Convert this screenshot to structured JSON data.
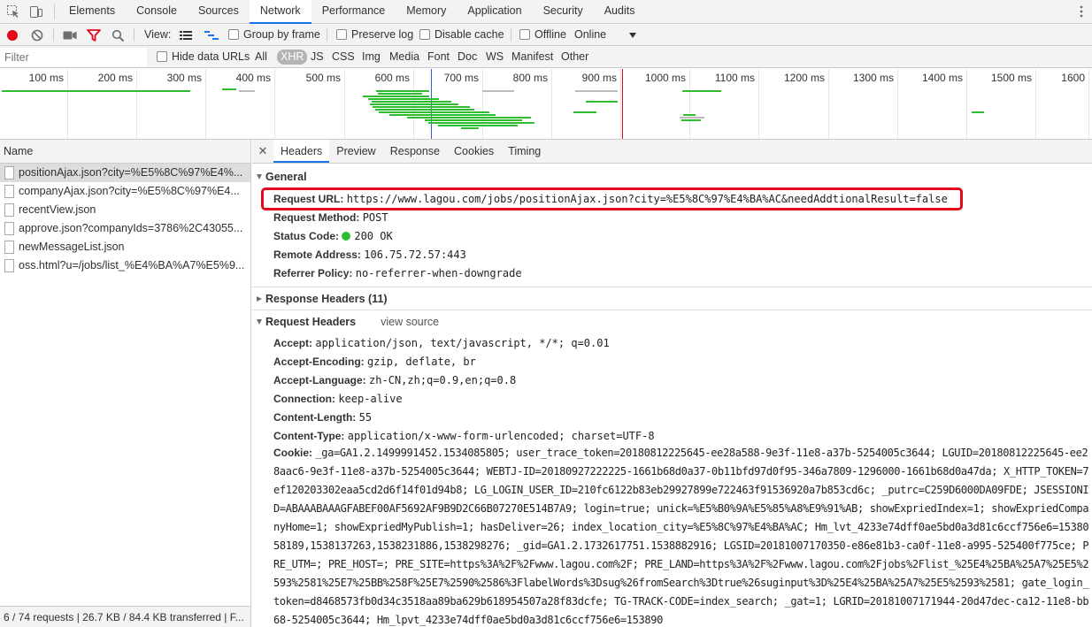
{
  "devtools_tabs": [
    "Elements",
    "Console",
    "Sources",
    "Network",
    "Performance",
    "Memory",
    "Application",
    "Security",
    "Audits"
  ],
  "active_tab": "Network",
  "toolbar": {
    "view_label": "View:",
    "group_by_frame": "Group by frame",
    "preserve_log": "Preserve log",
    "disable_cache": "Disable cache",
    "offline": "Offline",
    "throttle": "Online"
  },
  "filter": {
    "placeholder": "Filter",
    "hide_data_urls": "Hide data URLs",
    "types": [
      "All",
      "XHR",
      "JS",
      "CSS",
      "Img",
      "Media",
      "Font",
      "Doc",
      "WS",
      "Manifest",
      "Other"
    ],
    "active_type": "XHR"
  },
  "timeline": {
    "ticks": [
      "100 ms",
      "200 ms",
      "300 ms",
      "400 ms",
      "500 ms",
      "600 ms",
      "700 ms",
      "800 ms",
      "900 ms",
      "1000 ms",
      "1100 ms",
      "1200 ms",
      "1300 ms",
      "1400 ms",
      "1500 ms",
      "1600"
    ]
  },
  "request_list": {
    "header": "Name",
    "rows": [
      "positionAjax.json?city=%E5%8C%97%E4%...",
      "companyAjax.json?city=%E5%8C%97%E4...",
      "recentView.json",
      "approve.json?companyIds=3786%2C43055...",
      "newMessageList.json",
      "oss.html?u=/jobs/list_%E4%BA%A7%E5%9..."
    ],
    "footer": "6 / 74 requests | 26.7 KB / 84.4 KB transferred | F..."
  },
  "detail": {
    "tabs": [
      "Headers",
      "Preview",
      "Response",
      "Cookies",
      "Timing"
    ],
    "active_tab": "Headers",
    "general": {
      "title": "General",
      "request_url_label": "Request URL:",
      "request_url": "https://www.lagou.com/jobs/positionAjax.json?city=%E5%8C%97%E4%BA%AC&needAddtionalResult=false",
      "request_method_label": "Request Method:",
      "request_method": "POST",
      "status_code_label": "Status Code:",
      "status_code": "200 OK",
      "remote_address_label": "Remote Address:",
      "remote_address": "106.75.72.57:443",
      "referrer_policy_label": "Referrer Policy:",
      "referrer_policy": "no-referrer-when-downgrade"
    },
    "response_headers_title": "Response Headers (11)",
    "request_headers_title": "Request Headers",
    "view_source": "view source",
    "request_headers": [
      {
        "key": "Accept:",
        "value": "application/json, text/javascript, */*; q=0.01"
      },
      {
        "key": "Accept-Encoding:",
        "value": "gzip, deflate, br"
      },
      {
        "key": "Accept-Language:",
        "value": "zh-CN,zh;q=0.9,en;q=0.8"
      },
      {
        "key": "Connection:",
        "value": "keep-alive"
      },
      {
        "key": "Content-Length:",
        "value": "55"
      },
      {
        "key": "Content-Type:",
        "value": "application/x-www-form-urlencoded; charset=UTF-8"
      }
    ],
    "cookie_label": "Cookie:",
    "cookie_value": "_ga=GA1.2.1499991452.1534085805; user_trace_token=20180812225645-ee28a588-9e3f-11e8-a37b-5254005c3644; LGUID=20180812225645-ee28aac6-9e3f-11e8-a37b-5254005c3644; WEBTJ-ID=20180927222225-1661b68d0a37-0b11bfd97d0f95-346a7809-1296000-1661b68d0a47da; X_HTTP_TOKEN=7ef120203302eaa5cd2d6f14f01d94b8; LG_LOGIN_USER_ID=210fc6122b83eb29927899e722463f91536920a7b853cd6c; _putrc=C259D6000DA09FDE; JSESSIONID=ABAAABAAAGFABEF00AF5692AF9B9D2C66B07270E514B7A9; login=true; unick=%E5%B0%9A%E5%85%A8%E9%91%AB; showExpriedIndex=1; showExpriedCompanyHome=1; showExpriedMyPublish=1; hasDeliver=26; index_location_city=%E5%8C%97%E4%BA%AC; Hm_lvt_4233e74dff0ae5bd0a3d81c6ccf756e6=1538058189,1538137263,1538231886,1538298276; _gid=GA1.2.1732617751.1538882916; LGSID=20181007170350-e86e81b3-ca0f-11e8-a995-525400f775ce; PRE_UTM=; PRE_HOST=; PRE_SITE=https%3A%2F%2Fwww.lagou.com%2F; PRE_LAND=https%3A%2F%2Fwww.lagou.com%2Fjobs%2Flist_%25E4%25BA%25A7%25E5%2593%2581%25E7%25BB%258F%25E7%2590%2586%3FlabelWords%3Dsug%26fromSearch%3Dtrue%26suginput%3D%25E4%25BA%25A7%25E5%2593%2581; gate_login_token=d8468573fb0d34c3518aa89ba629b618954507a28f83dcfe; TG-TRACK-CODE=index_search; _gat=1; LGRID=20181007171944-20d47dec-ca12-11e8-bb68-5254005c3644; Hm_lpvt_4233e74dff0ae5bd0a3d81c6ccf756e6=153890"
  },
  "colors": {
    "record": "#e3081a",
    "filter_icon": "#e3081a",
    "highlight_box": "#e3081a",
    "status_ok": "#2fbd2f",
    "active_tab_underline": "#1a73e8",
    "waterfall_green": "#2fbd2f"
  }
}
